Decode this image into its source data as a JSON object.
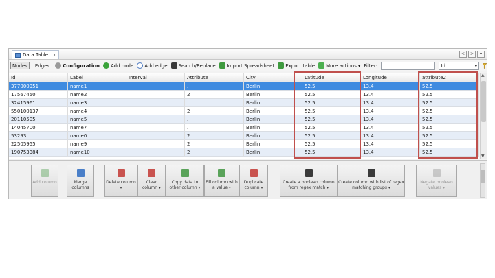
{
  "window": {
    "tab_label": "Data Table",
    "tab_close": "x",
    "nav_left": "<",
    "nav_right": ">",
    "menu": "▾"
  },
  "toolbar": {
    "nodes_label": "Nodes",
    "edges_label": "Edges",
    "configuration_label": "Configuration",
    "add_node_label": "Add node",
    "add_edge_label": "Add edge",
    "search_replace_label": "Search/Replace",
    "import_spreadsheet_label": "Import Spreadsheet",
    "export_table_label": "Export table",
    "more_actions_label": "More actions",
    "filter_label": "Filter:",
    "filter_value": "",
    "filter_column_value": "Id"
  },
  "table": {
    "columns": [
      "Id",
      "Label",
      "Interval",
      "Attribute",
      "City",
      "Latitude",
      "Longitude",
      "attribute2"
    ],
    "rows": [
      [
        "377000951",
        "name1",
        "",
        ".",
        "Berlin",
        "52.5",
        "13.4",
        "52.5"
      ],
      [
        "17567450",
        "name2",
        "",
        "2",
        "Berlin",
        "52.5",
        "13.4",
        "52.5"
      ],
      [
        "32415961",
        "name3",
        "",
        ".",
        "Berlin",
        "52.5",
        "13.4",
        "52.5"
      ],
      [
        "550100137",
        "name4",
        "",
        "2",
        "Berlin",
        "52.5",
        "13.4",
        "52.5"
      ],
      [
        "20110505",
        "name5",
        "",
        ".",
        "Berlin",
        "52.5",
        "13.4",
        "52.5"
      ],
      [
        "14045700",
        "name7",
        "",
        ".",
        "Berlin",
        "52.5",
        "13.4",
        "52.5"
      ],
      [
        "53293",
        "name0",
        "",
        "2",
        "Berlin",
        "52.5",
        "13.4",
        "52.5"
      ],
      [
        "22505955",
        "name9",
        "",
        "2",
        "Berlin",
        "52.5",
        "13.4",
        "52.5"
      ],
      [
        "190753384",
        "name10",
        "",
        "2",
        "Berlin",
        "52.5",
        "13.4",
        "52.5"
      ]
    ]
  },
  "actions": {
    "add_column": "Add column",
    "merge_columns": "Merge columns",
    "delete_column": "Delete column ▾",
    "clear_column": "Clear column ▾",
    "copy_data": "Copy data to other column ▾",
    "fill_column": "Fill column with a value ▾",
    "duplicate_column": "Duplicate column ▾",
    "create_boolean_column": "Create a boolean column from regex match ▾",
    "create_column_regex_list": "Create column with list of regex matching groups ▾",
    "negate_boolean": "Negate boolean values ▾"
  },
  "colors": {
    "selection": "#3f8be0",
    "alt_row": "#e6edf7",
    "highlight_box": "#c0504d"
  }
}
